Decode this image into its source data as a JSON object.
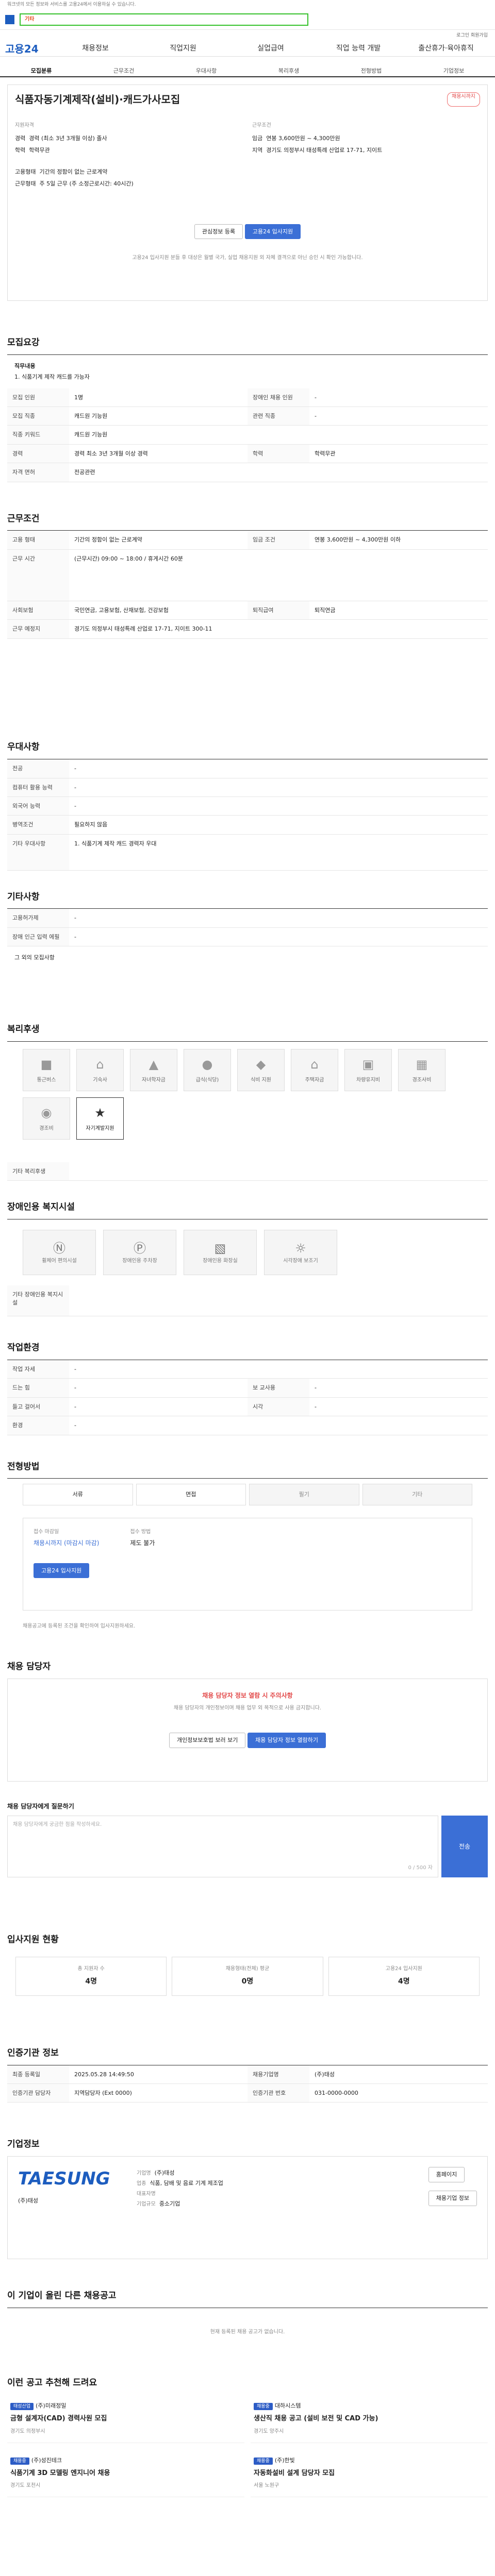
{
  "topline": "워크넷의 모든 정보와 서비스를 고용24에서 이용하실 수 있습니다.",
  "search": {
    "value": "기타"
  },
  "subhdr": "로그인   회원가입",
  "gnb": {
    "logo": "고용24",
    "items": [
      "채용정보",
      "직업지원",
      "실업급여",
      "직업 능력 개발",
      "출산휴가·육아휴직"
    ]
  },
  "tabs": [
    "모집분류",
    "근무조건",
    "우대사항",
    "복리후생",
    "전형방법",
    "기업정보"
  ],
  "job": {
    "title": "식품자동기계제작(설비)·캐드가사모집",
    "badge": "채용시까지",
    "company": "(주)태성",
    "field_label": "지원자격",
    "type_label": "근무조건",
    "rows1": [
      [
        "경력",
        "경력 (최소 3년 3개월 이상) 졸사"
      ],
      [
        "학력",
        "학력무관"
      ]
    ],
    "rows2": [
      [
        "임금",
        "연봉 3,600만원 ~ 4,300만원"
      ],
      [
        "지역",
        "경기도 의정부시 태성특례 산업로 17-71, 지이트"
      ]
    ],
    "rows3": [
      [
        "고용형태",
        "기간의 정함이 없는 근로계약"
      ],
      [
        "근무형태",
        "주 5일 근무 (주 소정근로시간: 40시간)"
      ]
    ],
    "btn_save": "관심정보 등록",
    "btn_apply": "고용24 입사지원",
    "note": "고용24 입사지원 분들 후 대상은 월별 국가, 실업 채용지원 외 자체 결격으로 아닌 승인 시 확인 가능합니다."
  },
  "recruit": {
    "title": "모집요강",
    "job_title": "직무내용",
    "job_desc": "1. 식품기계 제작 캐드를 가능자",
    "rows": [
      [
        "모집 인원",
        "1명",
        "장애인 채용 인원",
        "-"
      ],
      [
        "모집 직종",
        "캐드원 기능원",
        "관련 직종",
        "-"
      ],
      [
        "직종 키워드",
        "캐드원 기능원",
        "",
        ""
      ],
      [
        "경력",
        "경력 최소 3년 3개월 이상 경력",
        "학력",
        "학력무관"
      ],
      [
        "자격 면허",
        "전공관련",
        "",
        ""
      ]
    ]
  },
  "cond": {
    "title": "근무조건",
    "rows": [
      [
        "고용 형태",
        "기간의 정함이 없는 근로계약",
        "임금 조건",
        "연봉 3,600만원 ~ 4,300만원 이하"
      ],
      [
        "근무 시간",
        "(근무시간) 09:00 ~ 18:00 / 휴게시간 60분",
        "",
        ""
      ],
      [
        "사회보험",
        "국민연금, 고용보험, 산재보험, 건강보험",
        "퇴직급여",
        "퇴직연금"
      ],
      [
        "근무 예정지",
        "경기도 의정부시 태성특례 산업로 17-71, 지이트 300-11",
        "",
        ""
      ]
    ]
  },
  "pref": {
    "title": "우대사항",
    "rows": [
      [
        "전공",
        "-"
      ],
      [
        "컴퓨터 활용 능력",
        "-"
      ],
      [
        "외국어 능력",
        "-"
      ],
      [
        "병역조건",
        "필요하지 않음"
      ],
      [
        "기타 우대사항",
        "1. 식품기계 제작 캐드 경력자 우대"
      ]
    ]
  },
  "etc": {
    "title": "기타사항",
    "rows": [
      [
        "고용허가제",
        "-"
      ],
      [
        "장애 인근 입력 에필",
        "-"
      ]
    ],
    "extra": "그 외의 모집사항"
  },
  "welfare": {
    "title": "복리후생",
    "items": [
      "통근버스",
      "기숙사",
      "자녀학자금",
      "급식(식당)",
      "식비 지원",
      "주택자금",
      "차량유지비",
      "경조사비",
      "경조비",
      "자기계발지원"
    ],
    "other_label": "기타 복리후생"
  },
  "disabled": {
    "title": "장애인용 복지시설",
    "items": [
      "휠체어 편의시설",
      "장애인용 주차장",
      "장애인용 화장실",
      "시각장애 보조기"
    ],
    "other": "기타 장애인용 복지시설"
  },
  "place": {
    "title": "작업환경",
    "rows": [
      [
        "작업 자세",
        "-"
      ],
      [
        "드는 힘",
        "-",
        "보 교사용",
        "-"
      ],
      [
        "들고 걸어서",
        "-",
        "시각",
        "-"
      ],
      [
        "환경",
        "-"
      ]
    ]
  },
  "process": {
    "title": "전형방법",
    "steps": [
      "서류",
      "면접",
      "필기",
      "기타"
    ],
    "rows": [
      [
        "접수 마감일",
        "채용시까지 (마감시 마감)",
        "접수 방법",
        "제도 불가"
      ]
    ],
    "apply": "고용24 입사지원",
    "notes": "채용공고에 등록된 조건을 확인하여 입사지원하세요."
  },
  "manager": {
    "title": "채용 담당자",
    "notice": "채용 담당자 정보 열람 시 주의사항",
    "desc": "채용 담당자의 개인정보이며 채용 업무 외 목적으로 사용 금지합니다.",
    "btn1": "개인정보보호법 보러 보기",
    "btn2": "채용 담당자 정보 열람하기"
  },
  "ask": {
    "title": "채용 담당자에게 질문하기",
    "ph": "채용 담당자에게 궁금한 점을 작성하세요.",
    "count": "0 / 500 자",
    "submit": "전송"
  },
  "stats": {
    "title": "입사지원 현황",
    "boxes": [
      [
        "총 지원자 수",
        "4명"
      ],
      [
        "채용형태(전체) 평균",
        "0명"
      ],
      [
        "고용24 입사지원",
        "4명"
      ]
    ]
  },
  "agency": {
    "title": "인증기관 정보",
    "rows": [
      [
        "최종 등록일",
        "2025.05.28 14:49:50",
        "채용기업명",
        "(주)태성"
      ],
      [
        "인증기관 담당자",
        "지역담당자 (Ext 0000)",
        "인증기관 번호",
        "031-0000-0000"
      ]
    ]
  },
  "company": {
    "title": "기업정보",
    "logo": "TAESUNG",
    "name": "(주)태성",
    "rows": [
      [
        "기업명",
        "(주)태성"
      ],
      [
        "업종",
        "식품, 담배 및 음료 기계 제조업"
      ],
      [
        "대표자명",
        ""
      ],
      [
        "기업규모",
        "중소기업"
      ]
    ],
    "btn1": "홈페이지",
    "btn2": "채용기업 정보"
  },
  "similar": {
    "title": "이 기업이 올린 다른 채용공고",
    "empty": "현재 등록된 채용 공고가 없습니다."
  },
  "rec": {
    "title": "이런 공고 추천해 드려요",
    "items": [
      {
        "tag": "태성산업",
        "company": "(주)미래정밀",
        "title": "금형 설계자(CAD) 경력사원 모집",
        "info": "경기도 의정부시"
      },
      {
        "tag": "채용중",
        "company": "대하시스템",
        "title": "생산직 채용 공고 (설비 보전 및 CAD 가능)",
        "info": "경기도 양주시"
      },
      {
        "tag": "채용중",
        "company": "(주)성진테크",
        "title": "식품기계 3D 모델링 엔지니어 채용",
        "info": "경기도 포천시"
      },
      {
        "tag": "채용중",
        "company": "(주)한빛",
        "title": "자동화설비 설계 담당자 모집",
        "info": "서울 노원구"
      }
    ]
  }
}
